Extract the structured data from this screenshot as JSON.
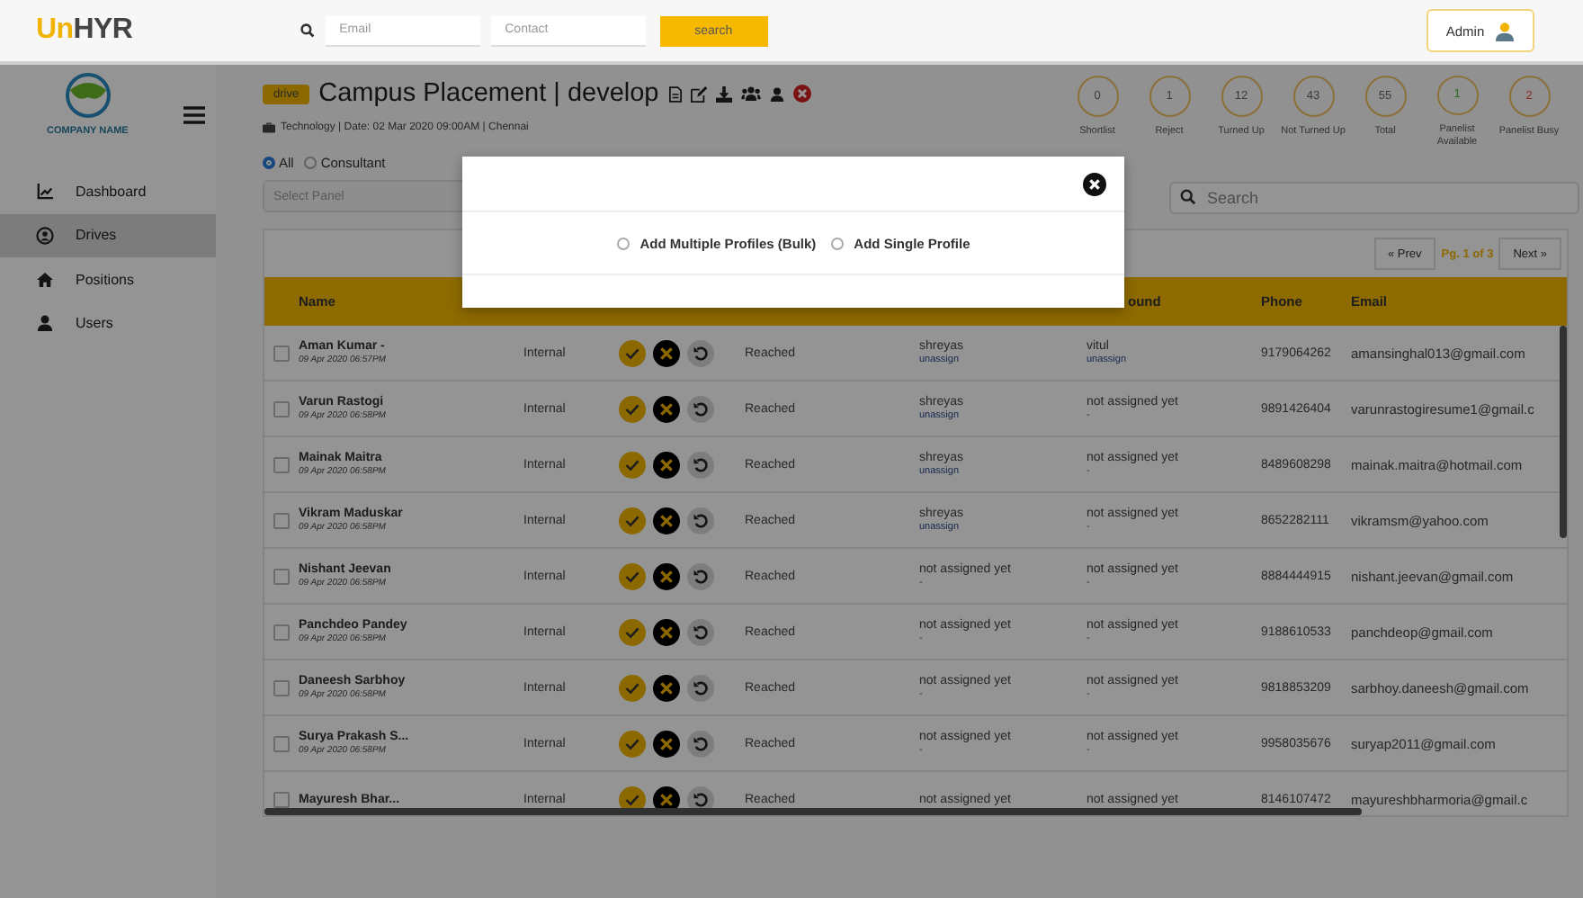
{
  "header": {
    "logo": {
      "accent": "Un",
      "rest": "HYR"
    },
    "email_placeholder": "Email",
    "contact_placeholder": "Contact",
    "search_button": "search",
    "user": "Admin"
  },
  "sidebar": {
    "company": "COMPANY NAME",
    "items": [
      {
        "label": "Dashboard",
        "kind": "chart",
        "selected": false
      },
      {
        "label": "Drives",
        "kind": "drives",
        "selected": true
      },
      {
        "label": "Positions",
        "kind": "home",
        "selected": false
      },
      {
        "label": "Users",
        "kind": "user",
        "selected": false
      }
    ]
  },
  "drive": {
    "badge": "drive",
    "title": "Campus Placement | develop",
    "meta": "Technology | Date: 02 Mar 2020 09:00AM | Chennai"
  },
  "stats": [
    {
      "value": "0",
      "label": "Shortlist",
      "color": "#3c3c3c"
    },
    {
      "value": "1",
      "label": "Reject",
      "color": "#3c3c3c"
    },
    {
      "value": "12",
      "label": "Turned Up",
      "color": "#3c3c3c"
    },
    {
      "value": "43",
      "label": "Not Turned Up",
      "color": "#3c3c3c"
    },
    {
      "value": "55",
      "label": "Total",
      "color": "#3c3c3c"
    },
    {
      "value": "1",
      "label": "Panelist Available",
      "color": "#2a6a1a"
    },
    {
      "value": "2",
      "label": "Panelist Busy",
      "color": "#8a2a1a"
    }
  ],
  "filters": {
    "options": [
      {
        "label": "All",
        "selected": true
      },
      {
        "label": "Consultant",
        "selected": false
      }
    ],
    "panel_placeholder": "Select Panel",
    "search_placeholder": "Search"
  },
  "pagination": {
    "prev": "« Prev",
    "page": "Pg. 1 of 3",
    "next": "Next »"
  },
  "table": {
    "columns": {
      "name": "Name",
      "column_6": "ound",
      "phone": "Phone",
      "email": "Email"
    },
    "rows": [
      {
        "name": "Aman Kumar -",
        "checked": false,
        "date": "09 Apr 2020 06:57PM",
        "source": "Internal",
        "status": "Reached",
        "panel": "shreyas",
        "panel_sub": {
          "kind": "link",
          "text": "unassign"
        },
        "round": "vitul",
        "round_sub": {
          "kind": "link",
          "text": "unassign"
        },
        "phone": "9179064262",
        "email": "amansinghal013@gmail.com"
      },
      {
        "name": "Varun Rastogi",
        "checked": false,
        "date": "09 Apr 2020 06:58PM",
        "source": "Internal",
        "status": "Reached",
        "panel": "shreyas",
        "panel_sub": {
          "kind": "link",
          "text": "unassign"
        },
        "round": "not assigned yet",
        "round_sub": {
          "kind": "dash",
          "text": "-"
        },
        "phone": "9891426404",
        "email": "varunrastogiresume1@gmail.c"
      },
      {
        "name": "Mainak Maitra",
        "checked": false,
        "date": "09 Apr 2020 06:58PM",
        "source": "Internal",
        "status": "Reached",
        "panel": "shreyas",
        "panel_sub": {
          "kind": "link",
          "text": "unassign"
        },
        "round": "not assigned yet",
        "round_sub": {
          "kind": "dash",
          "text": "-"
        },
        "phone": "8489608298",
        "email": "mainak.maitra@hotmail.com"
      },
      {
        "name": "Vikram Maduskar",
        "checked": false,
        "date": "09 Apr 2020 06:58PM",
        "source": "Internal",
        "status": "Reached",
        "panel": "shreyas",
        "panel_sub": {
          "kind": "link",
          "text": "unassign"
        },
        "round": "not assigned yet",
        "round_sub": {
          "kind": "dash",
          "text": "-"
        },
        "phone": "8652282111",
        "email": "vikramsm@yahoo.com"
      },
      {
        "name": "Nishant Jeevan",
        "checked": false,
        "date": "09 Apr 2020 06:58PM",
        "source": "Internal",
        "status": "Reached",
        "panel": "not assigned yet",
        "panel_sub": {
          "kind": "dash",
          "text": "-"
        },
        "round": "not assigned yet",
        "round_sub": {
          "kind": "dash",
          "text": "-"
        },
        "phone": "8884444915",
        "email": "nishant.jeevan@gmail.com"
      },
      {
        "name": "Panchdeo Pandey",
        "checked": false,
        "date": "09 Apr 2020 06:58PM",
        "source": "Internal",
        "status": "Reached",
        "panel": "not assigned yet",
        "panel_sub": {
          "kind": "dash",
          "text": "-"
        },
        "round": "not assigned yet",
        "round_sub": {
          "kind": "dash",
          "text": "-"
        },
        "phone": "9188610533",
        "email": "panchdeop@gmail.com"
      },
      {
        "name": "Daneesh Sarbhoy",
        "checked": false,
        "date": "09 Apr 2020 06:58PM",
        "source": "Internal",
        "status": "Reached",
        "panel": "not assigned yet",
        "panel_sub": {
          "kind": "dash",
          "text": "-"
        },
        "round": "not assigned yet",
        "round_sub": {
          "kind": "dash",
          "text": "-"
        },
        "phone": "9818853209",
        "email": "sarbhoy.daneesh@gmail.com"
      },
      {
        "name": "Surya Prakash S...",
        "checked": false,
        "date": "09 Apr 2020 06:58PM",
        "source": "Internal",
        "status": "Reached",
        "panel": "not assigned yet",
        "panel_sub": {
          "kind": "dash",
          "text": "-"
        },
        "round": "not assigned yet",
        "round_sub": {
          "kind": "dash",
          "text": "-"
        },
        "phone": "9958035676",
        "email": "suryap2011@gmail.com"
      },
      {
        "name": "Mayuresh Bhar...",
        "checked": false,
        "source": "Internal",
        "status": "Reached",
        "panel": "not assigned yet",
        "round": "not assigned yet",
        "phone": "8146107472",
        "email": "mayureshbharmoria@gmail.c"
      }
    ]
  },
  "modal": {
    "options": [
      {
        "label": "Add Multiple Profiles (Bulk)",
        "selected": false
      },
      {
        "label": "Add Single Profile",
        "selected": false
      }
    ]
  }
}
